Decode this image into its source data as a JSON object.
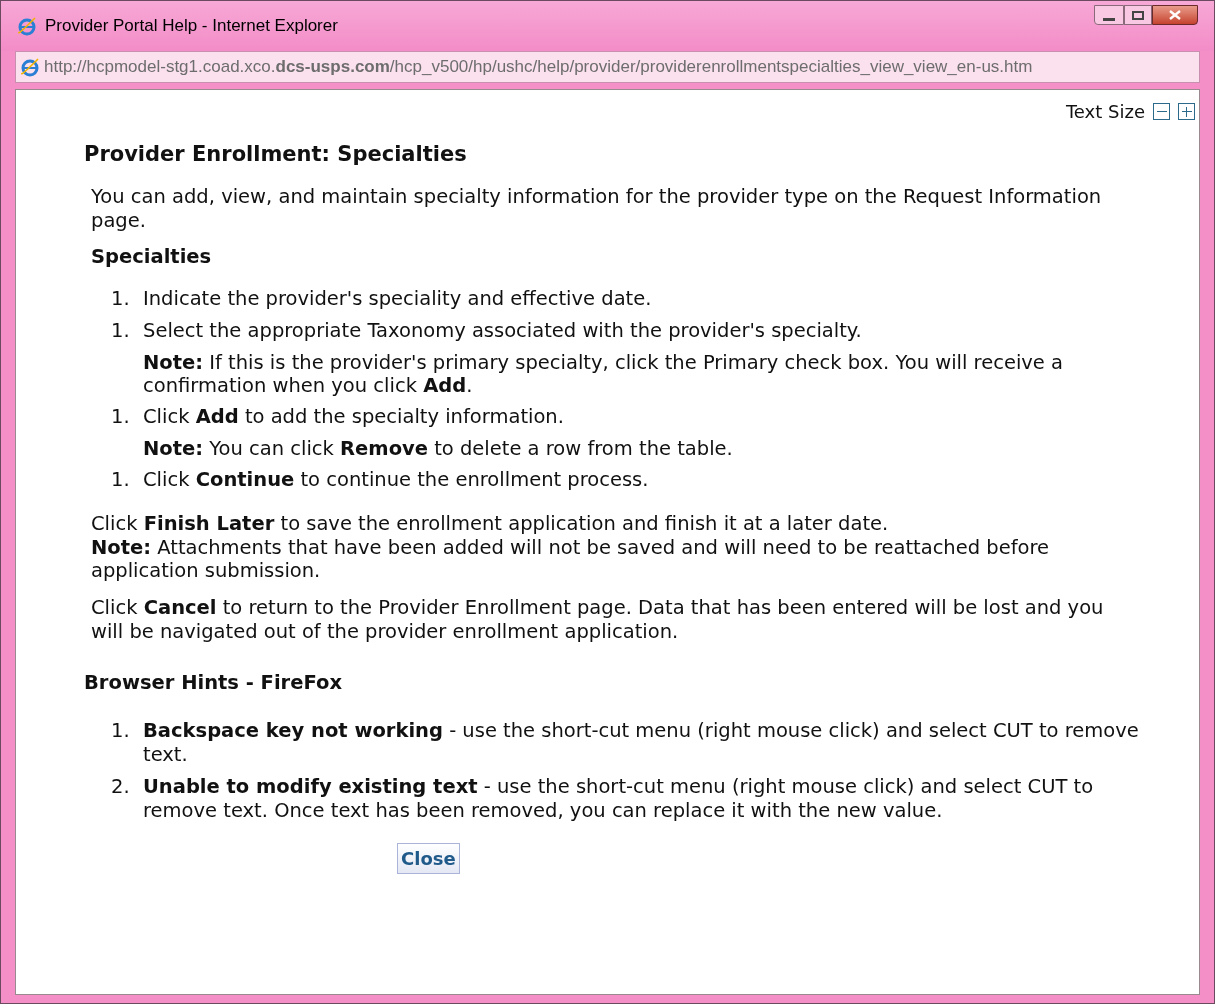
{
  "window": {
    "title": "Provider Portal Help - Internet Explorer"
  },
  "address_bar": {
    "url": "http://hcpmodel-stg1.coad.xco.**dcs-usps.com**/hcp_v500/hp/ushc/help/provider/providerenrollmentspecialties_view_view_en-us.htm"
  },
  "text_size": {
    "label": "Text Size"
  },
  "heading": "Provider Enrollment: Specialties",
  "intro": "You can add, view, and maintain specialty information for the provider type on the Request Information page.",
  "section_heading": "Specialties",
  "steps": [
    {
      "number": "1.",
      "text": "Indicate the provider's speciality and effective date."
    },
    {
      "number": "1.",
      "text": "Select the appropriate Taxonomy associated with the provider's specialty.",
      "note": "**Note:** If this is the provider's primary specialty, click the Primary check box. You will receive a confirmation when you click **Add**."
    },
    {
      "number": "1.",
      "text": "Click **Add** to add the specialty information.",
      "note": "**Note:** You can click **Remove** to delete a row from the table."
    },
    {
      "number": "1.",
      "text": "Click **Continue** to continue the enrollment process."
    }
  ],
  "finish_later": "Click **Finish Later** to save the enrollment application and finish it at a later date.",
  "attachments_note": "**Note:** Attachments that have been added will not be saved and will need to be reattached before application submission.",
  "cancel_text": "Click **Cancel** to return to the Provider Enrollment page. Data that has been entered will be lost and you will be navigated out of the provider enrollment application.",
  "hints_heading": "Browser Hints - FireFox",
  "hints": [
    {
      "number": "1.",
      "text": "**Backspace key not working** - use the short-cut menu (right mouse click) and select CUT to remove text."
    },
    {
      "number": "2.",
      "text": "**Unable to modify existing text** - use the short-cut menu (right mouse click) and select CUT to remove text.  Once text has been removed, you can replace it with the new value."
    }
  ],
  "close_button": "Close"
}
